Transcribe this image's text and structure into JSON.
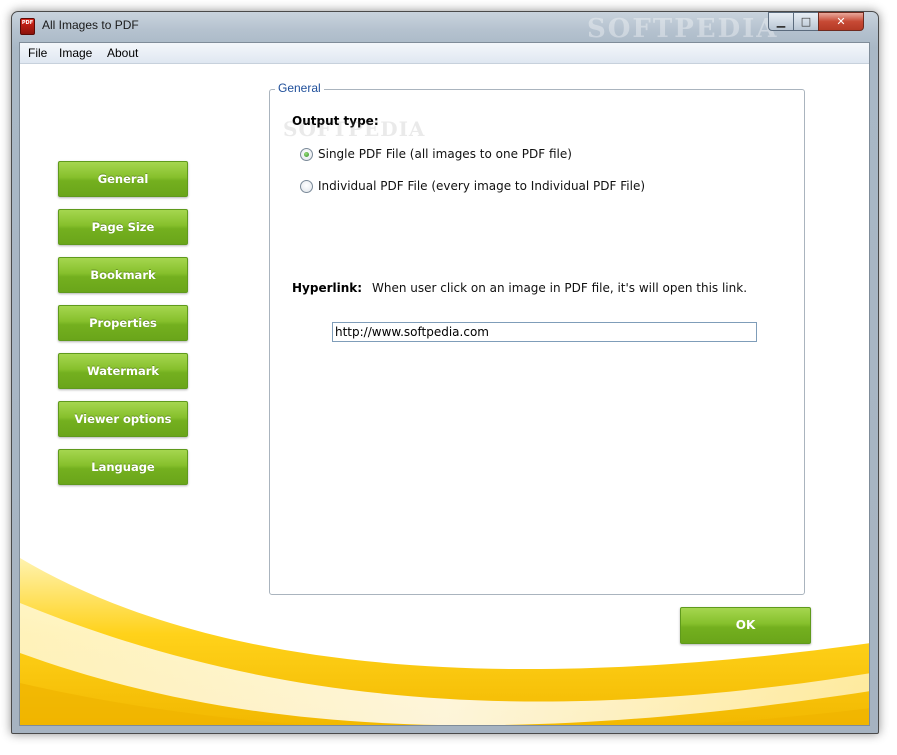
{
  "window": {
    "title": "All Images to PDF",
    "icon_text": "PDF",
    "watermark": "SOFTPEDIA",
    "minimize_glyph": "▁",
    "maximize_glyph": "□",
    "close_glyph": "✕"
  },
  "menu": [
    "File",
    "Image",
    "About"
  ],
  "nav": [
    "General",
    "Page Size",
    "Bookmark",
    "Properties",
    "Watermark",
    "Viewer options",
    "Language"
  ],
  "group": {
    "legend": "General",
    "output_type_label": "Output type:",
    "watermark": "SOFTPEDIA",
    "options": [
      {
        "label": "Single PDF File (all images to one PDF file)",
        "selected": true
      },
      {
        "label": "Individual PDF File (every image to Individual PDF File)",
        "selected": false
      }
    ],
    "hyperlink_label": "Hyperlink:",
    "hyperlink_hint": "When user click on an image in PDF file, it's will open this link.",
    "hyperlink_value": "http://www.softpedia.com"
  },
  "ok_label": "OK",
  "colors": {
    "button_green": "#7fbf2a",
    "accent_yellow": "#f5c400",
    "legend_blue": "#1e4e9a"
  }
}
